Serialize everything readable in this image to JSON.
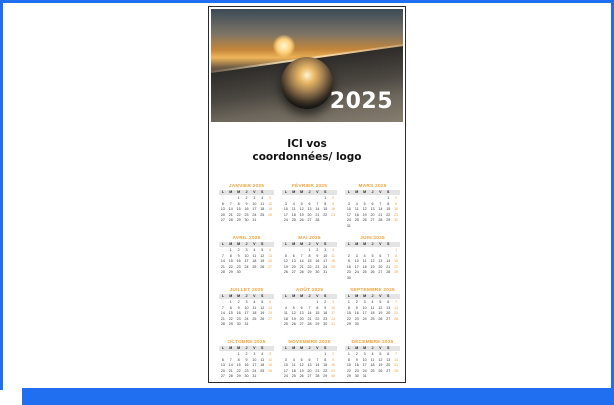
{
  "calendar": {
    "year": "2025",
    "contact_line1": "ICI vos",
    "contact_line2": "coordonnées/ logo",
    "weekday_headers": [
      "L",
      "M",
      "M",
      "J",
      "V",
      "S",
      ""
    ],
    "months": [
      {
        "name": "JANVIER 2025",
        "offset": 2,
        "days": 31
      },
      {
        "name": "FÉVRIER 2025",
        "offset": 5,
        "days": 28
      },
      {
        "name": "MARS 2025",
        "offset": 5,
        "days": 31
      },
      {
        "name": "AVRIL 2025",
        "offset": 1,
        "days": 30
      },
      {
        "name": "MAI 2025",
        "offset": 3,
        "days": 31
      },
      {
        "name": "JUIN 2025",
        "offset": 6,
        "days": 30
      },
      {
        "name": "JUILLET 2025",
        "offset": 1,
        "days": 31
      },
      {
        "name": "AOÛT 2025",
        "offset": 4,
        "days": 31
      },
      {
        "name": "SEPTEMBRE 2025",
        "offset": 0,
        "days": 30
      },
      {
        "name": "OCTOBRE 2025",
        "offset": 2,
        "days": 31
      },
      {
        "name": "NOVEMBRE 2025",
        "offset": 5,
        "days": 30
      },
      {
        "name": "DÉCEMBRE 2025",
        "offset": 0,
        "days": 31
      }
    ]
  },
  "colors": {
    "frame": "#1f6ff0",
    "month_title": "#f2a23a",
    "header_bg": "#e4e4e4"
  }
}
